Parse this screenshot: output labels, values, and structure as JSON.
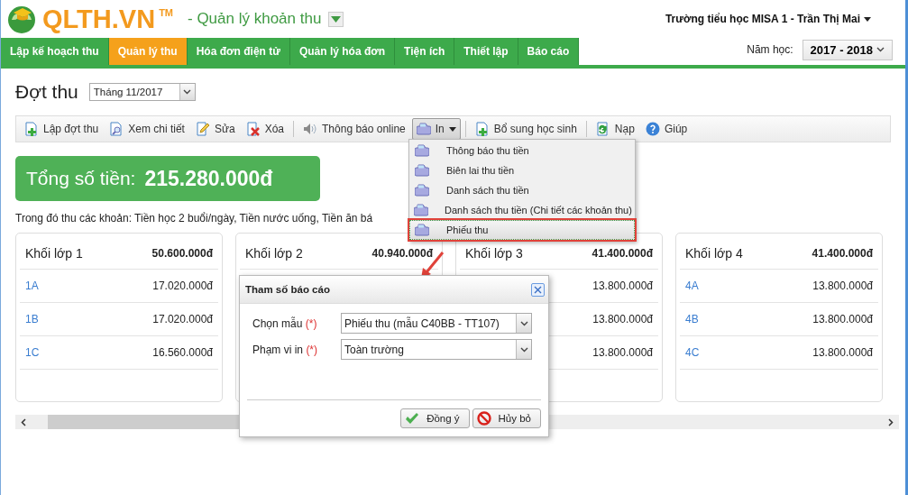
{
  "header": {
    "logo_text": "QLTH.VN",
    "trademark": "TM",
    "module_title": "- Quản lý khoản thu",
    "user": "Trường tiểu học MISA 1 - Trần Thị Mai"
  },
  "nav": {
    "tabs": [
      {
        "label": "Lập kế hoạch thu",
        "selected": false
      },
      {
        "label": "Quản lý thu",
        "selected": true
      },
      {
        "label": "Hóa đơn điện tử",
        "selected": false
      },
      {
        "label": "Quản lý hóa đơn",
        "selected": false
      },
      {
        "label": "Tiện ích",
        "selected": false
      },
      {
        "label": "Thiết lập",
        "selected": false
      },
      {
        "label": "Báo cáo",
        "selected": false
      }
    ],
    "year_label": "Năm học:",
    "year": "2017 - 2018"
  },
  "period": {
    "title": "Đợt thu",
    "value": "Tháng 11/2017"
  },
  "toolbar": [
    {
      "kind": "button",
      "label": "Lập đợt thu"
    },
    {
      "kind": "button",
      "label": "Xem chi tiết"
    },
    {
      "kind": "button",
      "label": "Sửa"
    },
    {
      "kind": "button",
      "label": "Xóa"
    },
    {
      "kind": "separator"
    },
    {
      "kind": "button",
      "label": "Thông báo online"
    },
    {
      "kind": "dropdown",
      "label": "In",
      "expanded": true
    },
    {
      "kind": "separator"
    },
    {
      "kind": "button",
      "label": "Bổ sung học sinh"
    },
    {
      "kind": "separator"
    },
    {
      "kind": "button",
      "label": "Nạp"
    },
    {
      "kind": "button",
      "label": "Giúp"
    }
  ],
  "print_menu": [
    {
      "label": "Thông báo thu tiền",
      "selected": false
    },
    {
      "label": "Biên lai thu tiền",
      "selected": false
    },
    {
      "label": "Danh sách thu tiền",
      "selected": false
    },
    {
      "label": "Danh sách thu tiền (Chi tiết các khoản thu)",
      "selected": false
    },
    {
      "label": "Phiếu thu",
      "selected": true
    }
  ],
  "total": {
    "label": "Tổng số tiền:",
    "amount": "215.280.000đ"
  },
  "description": "Trong đó thu các khoản: Tiền học 2 buổi/ngày, Tiền nước uống, Tiền ăn bá",
  "cards": [
    {
      "title": "Khối lớp 1",
      "amount": "50.600.000đ",
      "rows": [
        {
          "class": "1A",
          "amount": "17.020.000đ"
        },
        {
          "class": "1B",
          "amount": "17.020.000đ"
        },
        {
          "class": "1C",
          "amount": "16.560.000đ"
        }
      ]
    },
    {
      "title": "Khối lớp 2",
      "amount": "40.940.000đ"
    },
    {
      "title": "Khối lớp 3",
      "amount": "41.400.000đ",
      "rows": [
        {
          "amount": "13.800.000đ"
        },
        {
          "amount": "13.800.000đ"
        },
        {
          "amount": "13.800.000đ"
        }
      ]
    },
    {
      "title": "Khối lớp 4",
      "amount": "41.400.000đ",
      "rows": [
        {
          "class": "4A",
          "amount": "13.800.000đ"
        },
        {
          "class": "4B",
          "amount": "13.800.000đ"
        },
        {
          "class": "4C",
          "amount": "13.800.000đ"
        }
      ]
    }
  ],
  "dialog": {
    "title": "Tham số báo cáo",
    "fields": [
      {
        "label": "Chọn mẫu",
        "required_mark": "(*)",
        "value": "Phiếu thu (mẫu C40BB - TT107)"
      },
      {
        "label": "Phạm vi in",
        "required_mark": "(*)",
        "value": "Toàn trường"
      }
    ],
    "buttons": [
      {
        "kind": "ok",
        "label": "Đồng ý"
      },
      {
        "kind": "cancel",
        "label": "Hủy bỏ"
      }
    ]
  }
}
